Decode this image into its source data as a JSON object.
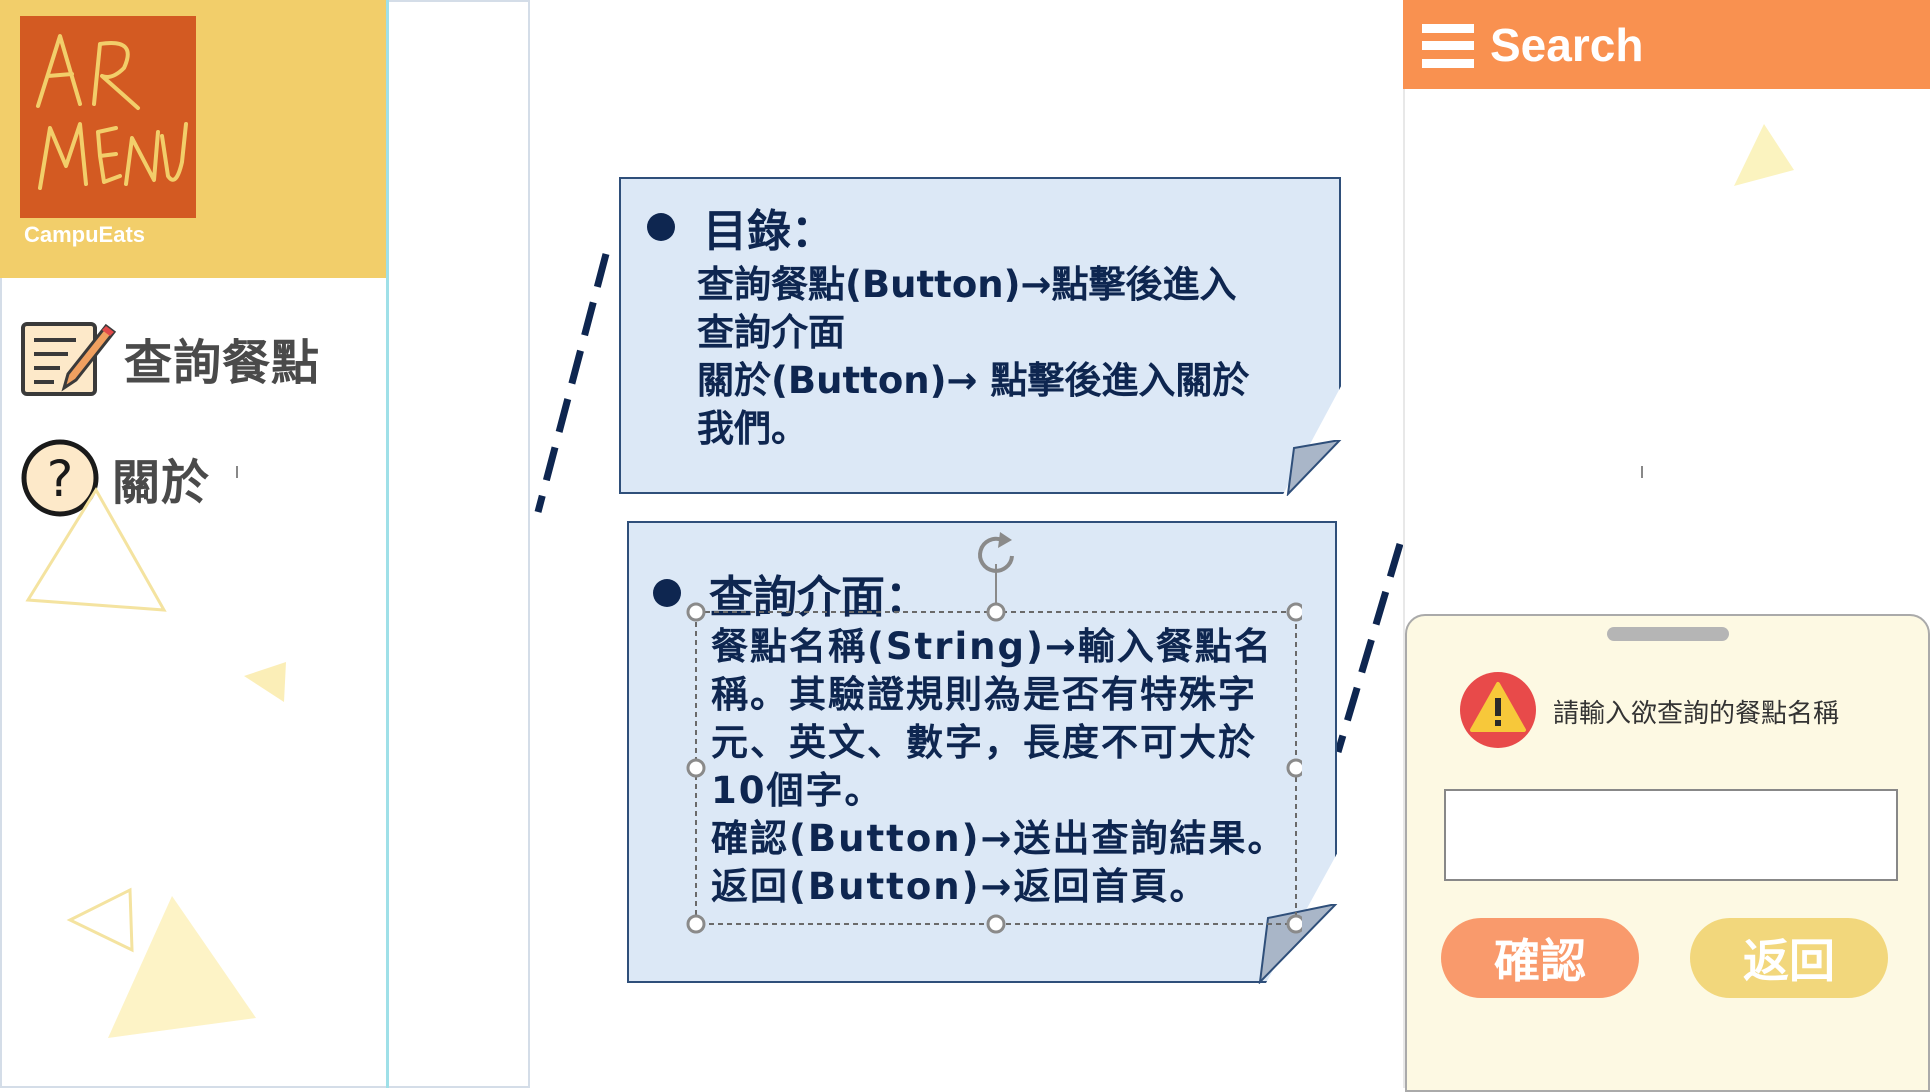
{
  "left_app": {
    "brand_name": "CampuEats",
    "logo_text": [
      "AR",
      "MENU"
    ],
    "menu": [
      {
        "icon": "notepad-pencil-icon",
        "label": "查詢餐點"
      },
      {
        "icon": "question-circle-icon",
        "label": "關於"
      }
    ]
  },
  "notes": {
    "toc": {
      "title": "目錄：",
      "body": "查詢餐點(Button)→點擊後進入\n查詢介面\n關於(Button)→ 點擊後進入關於\n我們。"
    },
    "search": {
      "title": "查詢介面：",
      "body": "餐點名稱(String)→輸入餐點名\n稱。其驗證規則為是否有特殊字\n元、英文、數字，長度不可大於\n10個字。\n確認(Button)→送出查詢結果。\n返回(Button)→返回首頁。"
    }
  },
  "right_app": {
    "header": {
      "icon": "hamburger-menu-icon",
      "title": "Search"
    },
    "dialog": {
      "icon": "warning-icon",
      "message": "請輸入欲查詢的餐點名稱",
      "input_value": "",
      "confirm_label": "確認",
      "back_label": "返回"
    }
  },
  "colors": {
    "brand_yellow": "#f2ce6a",
    "logo_orange": "#d35a22",
    "search_orange": "#f99150",
    "note_blue": "#dce8f6",
    "note_text": "#0e2650",
    "confirm_orange": "#f99a6c",
    "back_yellow": "#f2d77c",
    "warning_red": "#e84a4a"
  }
}
